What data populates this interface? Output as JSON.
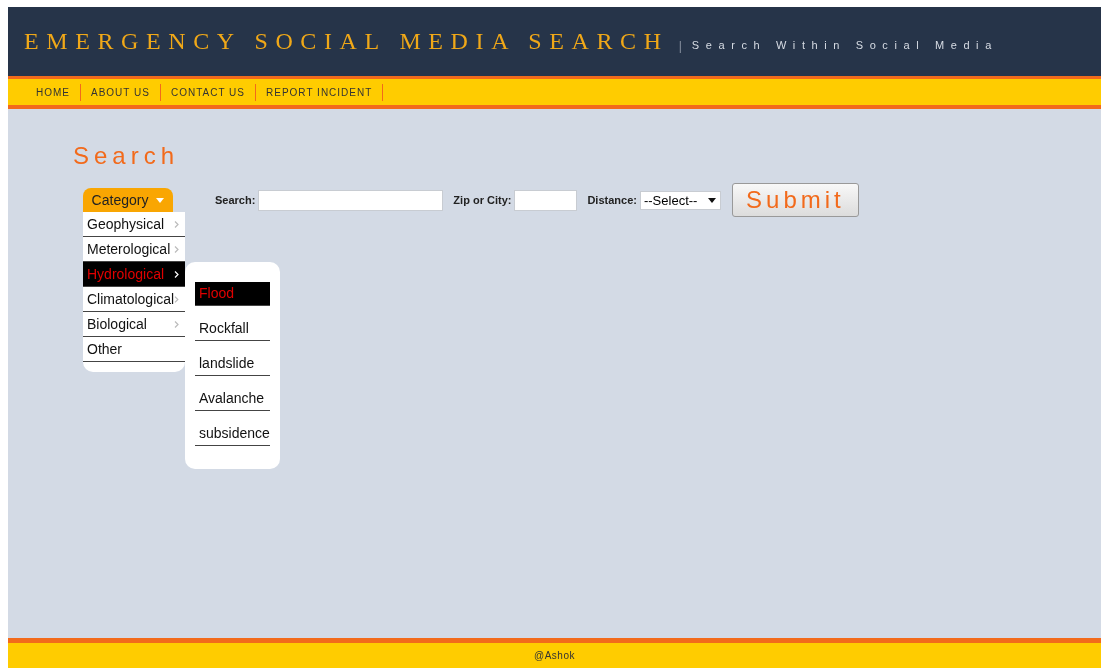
{
  "header": {
    "title": "EMERGENCY SOCIAL MEDIA SEARCH",
    "separator": "|",
    "tagline": "Search Within Social Media"
  },
  "nav": [
    {
      "label": "HOME"
    },
    {
      "label": "ABOUT US"
    },
    {
      "label": "CONTACT US"
    },
    {
      "label": "REPORT INCIDENT"
    }
  ],
  "heading": "Search",
  "category_menu": {
    "label": "Category",
    "items": [
      {
        "label": "Geophysical",
        "has_submenu": true,
        "selected": false
      },
      {
        "label": "Meterological",
        "has_submenu": true,
        "selected": false
      },
      {
        "label": "Hydrological",
        "has_submenu": true,
        "selected": true,
        "children": [
          {
            "label": "Flood",
            "selected": true
          },
          {
            "label": "Rockfall",
            "selected": false
          },
          {
            "label": "landslide",
            "selected": false
          },
          {
            "label": "Avalanche",
            "selected": false
          },
          {
            "label": "subsidence",
            "selected": false
          }
        ]
      },
      {
        "label": "Climatological",
        "has_submenu": true,
        "selected": false
      },
      {
        "label": "Biological",
        "has_submenu": true,
        "selected": false
      },
      {
        "label": "Other",
        "has_submenu": false,
        "selected": false
      }
    ]
  },
  "form": {
    "search_label": "Search:",
    "zip_label": "Zip or City:",
    "distance_label": "Distance:",
    "distance_value": "--Select--",
    "submit": "Submit"
  },
  "footer": "@Ashok"
}
